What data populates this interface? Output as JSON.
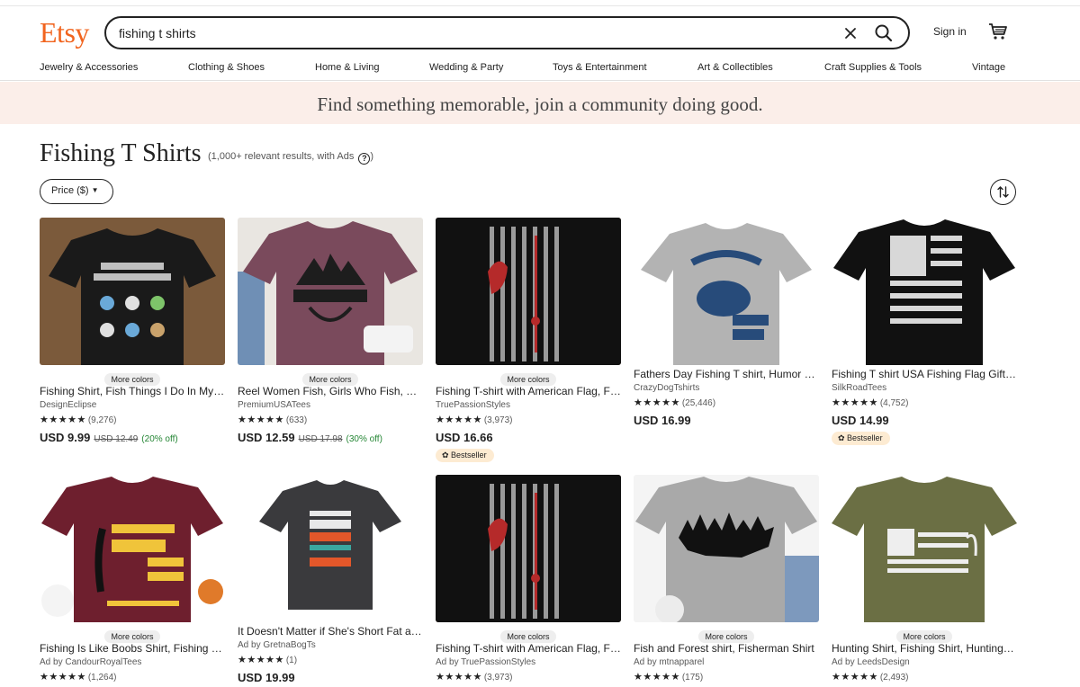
{
  "header": {
    "logo": "Etsy",
    "search_value": "fishing t shirts",
    "signin": "Sign in"
  },
  "nav": [
    "Jewelry & Accessories",
    "Clothing & Shoes",
    "Home & Living",
    "Wedding & Party",
    "Toys & Entertainment",
    "Art & Collectibles",
    "Craft Supplies & Tools",
    "Vintage"
  ],
  "banner": "Find something memorable, join a community doing good.",
  "page": {
    "title": "Fishing T Shirts",
    "results": "(1,000+ relevant results, with Ads",
    "results_close": ")",
    "help": "?",
    "price_filter": "Price ($)"
  },
  "products": [
    {
      "more_colors": "More colors",
      "title": "Fishing Shirt, Fish Things I Do In My Spare Time Shirt",
      "shop": "DesignEclipse",
      "stars": "★★★★★",
      "reviews": "(9,276)",
      "price": "USD 9.99",
      "orig_price": "USD 12.49",
      "discount": "(20% off)",
      "badge": "",
      "shirt_color": "#1a1a1a",
      "bg": "#7b5a3b"
    },
    {
      "more_colors": "More colors",
      "title": "Reel Women Fish, Girls Who Fish, Fishing Shirt",
      "shop": "PremiumUSATees",
      "stars": "★★★★★",
      "reviews": "(633)",
      "price": "USD 12.59",
      "orig_price": "USD 17.98",
      "discount": "(30% off)",
      "badge": "",
      "shirt_color": "#7a4a5c",
      "bg": "#e9e6e1"
    },
    {
      "more_colors": "More colors",
      "title": "Fishing T-shirt with American Flag, Fishing Gift",
      "shop": "TruePassionStyles",
      "stars": "★★★★★",
      "reviews": "(3,973)",
      "price": "USD 16.66",
      "orig_price": "",
      "discount": "",
      "badge": "Bestseller",
      "shirt_color": "#111111",
      "bg": "#6b4a32"
    },
    {
      "more_colors": "",
      "title": "Fathers Day Fishing T shirt, Humor Dumb Bass",
      "shop": "CrazyDogTshirts",
      "stars": "★★★★★",
      "reviews": "(25,446)",
      "price": "USD 16.99",
      "orig_price": "",
      "discount": "",
      "badge": "",
      "shirt_color": "#b3b3b3",
      "bg": "#ffffff"
    },
    {
      "more_colors": "",
      "title": "Fishing T shirt USA Fishing Flag Gift for Him",
      "shop": "SilkRoadTees",
      "stars": "★★★★★",
      "reviews": "(4,752)",
      "price": "USD 14.99",
      "orig_price": "",
      "discount": "",
      "badge": "Bestseller",
      "shirt_color": "#111111",
      "bg": "#ffffff"
    },
    {
      "more_colors": "More colors",
      "title": "Fishing Is Like Boobs Shirt, Fishing Lover Gift",
      "shop": "Ad by CandourRoyalTees",
      "stars": "★★★★★",
      "reviews": "(1,264)",
      "price": "",
      "orig_price": "",
      "discount": "",
      "badge": "",
      "shirt_color": "#6e1f2e",
      "bg": "#ffffff"
    },
    {
      "more_colors": "",
      "title": "It Doesn't Matter if She's Short Fat all She Swallows",
      "shop": "Ad by GretnaBogTs",
      "stars": "★★★★★",
      "reviews": "(1)",
      "price": "USD 19.99",
      "orig_price": "",
      "discount": "",
      "badge": "",
      "shirt_color": "#3a3a3d",
      "bg": "#ffffff"
    },
    {
      "more_colors": "More colors",
      "title": "Fishing T-shirt with American Flag, Fishing Gift",
      "shop": "Ad by TruePassionStyles",
      "stars": "★★★★★",
      "reviews": "(3,973)",
      "price": "",
      "orig_price": "",
      "discount": "",
      "badge": "",
      "shirt_color": "#111111",
      "bg": "#6b4a32"
    },
    {
      "more_colors": "More colors",
      "title": "Fish and Forest shirt, Fisherman Shirt",
      "shop": "Ad by mtnapparel",
      "stars": "★★★★★",
      "reviews": "(175)",
      "price": "",
      "orig_price": "",
      "discount": "",
      "badge": "",
      "shirt_color": "#a9a9a9",
      "bg": "#f4f4f4"
    },
    {
      "more_colors": "More colors",
      "title": "Hunting Shirt, Fishing Shirt, Hunting and Fishing",
      "shop": "Ad by LeedsDesign",
      "stars": "★★★★★",
      "reviews": "(2,493)",
      "price": "",
      "orig_price": "",
      "discount": "",
      "badge": "",
      "shirt_color": "#6b6f44",
      "bg": "#ffffff"
    }
  ],
  "colors": {
    "brand": "#f1641e",
    "banner_bg": "#fbeee9",
    "discount": "#258635",
    "badge_bg": "#fdebd2"
  }
}
